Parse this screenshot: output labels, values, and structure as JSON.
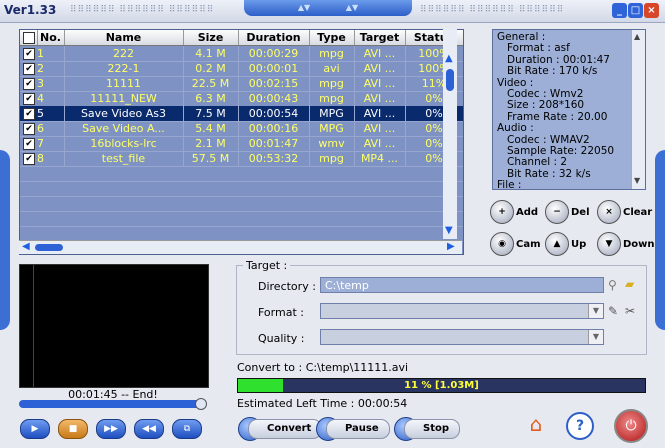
{
  "app": {
    "version": "Ver1.33"
  },
  "table": {
    "headers": [
      "No.",
      "Name",
      "Size",
      "Duration",
      "Type",
      "Target",
      "Status"
    ],
    "rows": [
      {
        "no": "1",
        "name": "222",
        "size": "4.1 M",
        "duration": "00:00:29",
        "type": "mpg",
        "target": "AVI ...",
        "status": "100%",
        "selected": false
      },
      {
        "no": "2",
        "name": "222-1",
        "size": "0.2 M",
        "duration": "00:00:01",
        "type": "avi",
        "target": "AVI ...",
        "status": "100%",
        "selected": false
      },
      {
        "no": "3",
        "name": "11111",
        "size": "22.5 M",
        "duration": "00:02:15",
        "type": "mpg",
        "target": "AVI ...",
        "status": "11%",
        "selected": false
      },
      {
        "no": "4",
        "name": "11111_NEW",
        "size": "6.3 M",
        "duration": "00:00:43",
        "type": "mpg",
        "target": "AVI ...",
        "status": "0%",
        "selected": false
      },
      {
        "no": "5",
        "name": "Save Video As3",
        "size": "7.5 M",
        "duration": "00:00:54",
        "type": "MPG",
        "target": "AVI ...",
        "status": "0%",
        "selected": true
      },
      {
        "no": "6",
        "name": "Save Video A...",
        "size": "5.4 M",
        "duration": "00:00:16",
        "type": "MPG",
        "target": "AVI ...",
        "status": "0%",
        "selected": false
      },
      {
        "no": "7",
        "name": "16blocks-lrc",
        "size": "2.1 M",
        "duration": "00:01:47",
        "type": "wmv",
        "target": "AVI ...",
        "status": "0%",
        "selected": false
      },
      {
        "no": "8",
        "name": "test_file",
        "size": "57.5 M",
        "duration": "00:53:32",
        "type": "mpg",
        "target": "MP4 ...",
        "status": "0%",
        "selected": false
      }
    ]
  },
  "info": {
    "lines": [
      "General :",
      "   Format : asf",
      "   Duration : 00:01:47",
      "   Bit Rate : 170 k/s",
      "Video :",
      "   Codec : Wmv2",
      "   Size : 208*160",
      "   Frame Rate : 20.00",
      "Audio :",
      "   Codec : WMAV2",
      "   Sample Rate: 22050",
      "   Channel : 2",
      "   Bit Rate : 32 k/s",
      "File :"
    ]
  },
  "actions": {
    "add": "Add",
    "del": "Del",
    "clear": "Clear",
    "cam": "Cam",
    "up": "Up",
    "down": "Down"
  },
  "player": {
    "time": "00:01:45 -- End!",
    "seek_fraction": 1.0
  },
  "target": {
    "group_label": "Target :",
    "directory_label": "Directory :",
    "directory_value": "C:\\temp",
    "format_label": "Format :",
    "quality_label": "Quality :"
  },
  "convert": {
    "to_label": "Convert to : C:\\temp\\11111.avi",
    "progress_text": "11 % [1.03M]",
    "progress_percent": 11,
    "estimated": "Estimated Left Time : 00:00:54"
  },
  "buttons": {
    "convert": "Convert",
    "pause": "Pause",
    "stop": "Stop"
  }
}
